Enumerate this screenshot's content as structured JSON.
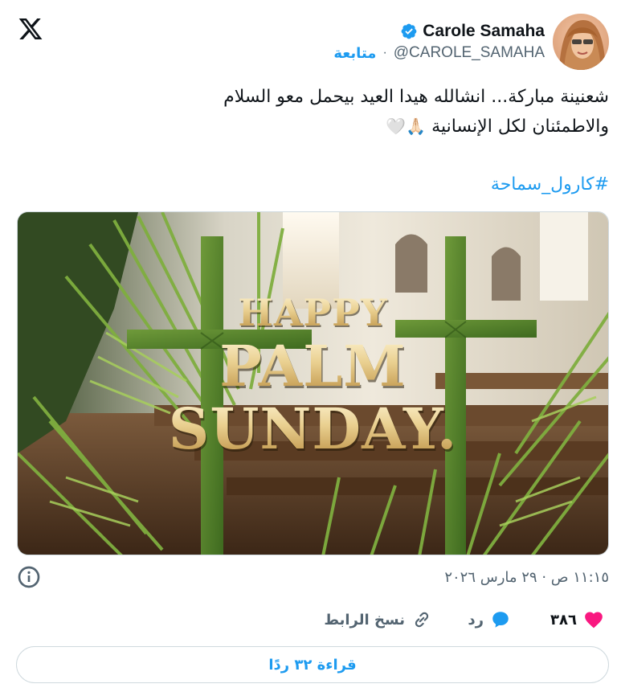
{
  "platform": {
    "logo_icon": "x-logo-icon"
  },
  "author": {
    "name": "Carole Samaha",
    "handle": "@CAROLE_SAMAHA",
    "separator": "·",
    "follow_label": "متابعة",
    "verified_icon": "verified-badge-icon",
    "avatar": "avatar-photo"
  },
  "tweet": {
    "line1": "شعنينة مباركة... انشالله هيدا العيد بيحمل معو السلام",
    "line2": "والاطمئنان لكل الإنسانية",
    "emojis": "🙏🏻🤍",
    "hashtag": "#كارول_سماحة"
  },
  "media": {
    "title_line1": "HAPPY",
    "title_line2": "PALM",
    "title_line3": "SUNDAY."
  },
  "meta": {
    "timestamp": "١١:١٥ ص · ٢٩ مارس ٢٠٢٦",
    "info_icon": "info-icon"
  },
  "actions": {
    "like_count": "٣٨٦",
    "reply_label": "رد",
    "copy_link_label": "نسخ الرابط"
  },
  "read_replies": "قراءة ٣٢ ردًا",
  "colors": {
    "accent": "#1d9bf0",
    "like": "#f91880",
    "text": "#0f1419",
    "muted": "#536471",
    "border": "#cfd9de"
  }
}
